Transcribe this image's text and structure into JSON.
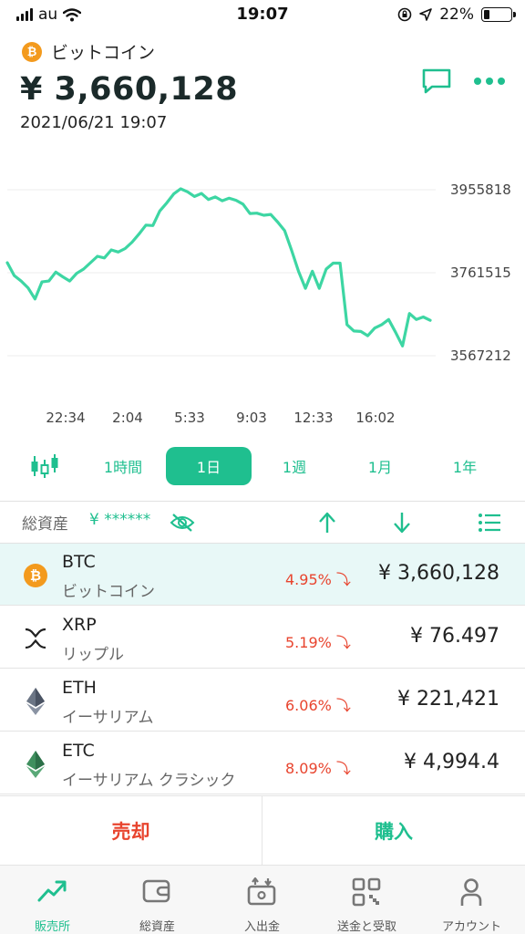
{
  "status_bar": {
    "carrier": "au",
    "time": "19:07",
    "battery": "22%"
  },
  "header": {
    "coin_name": "ビットコイン",
    "coin_symbol_glyph": "₿",
    "price": "¥ 3,660,128",
    "datetime": "2021/06/21 19:07",
    "icons": [
      "chat-icon",
      "more-icon"
    ]
  },
  "chart": {
    "y_labels": [
      "3955818",
      "3761515",
      "3567212"
    ],
    "x_labels": [
      "22:34",
      "2:04",
      "5:33",
      "9:03",
      "12:33",
      "16:02"
    ],
    "line_color": "#3dd6a3"
  },
  "chart_data": {
    "type": "line",
    "title": "",
    "xlabel": "",
    "ylabel": "",
    "x_ticks": [
      "22:34",
      "2:04",
      "5:33",
      "9:03",
      "12:33",
      "16:02"
    ],
    "y_ticks": [
      3955818,
      3761515,
      3567212
    ],
    "ylim": [
      3567212,
      3955818
    ],
    "series": [
      {
        "values": [
          3785000,
          3755000,
          3742000,
          3726000,
          3700000,
          3740000,
          3742000,
          3763000,
          3752000,
          3742000,
          3760000,
          3770000,
          3785000,
          3800000,
          3796000,
          3815000,
          3810000,
          3818000,
          3833000,
          3852000,
          3873000,
          3872000,
          3906000,
          3925000,
          3946000,
          3958000,
          3951000,
          3940000,
          3947000,
          3933000,
          3939000,
          3930000,
          3936000,
          3931000,
          3922000,
          3900000,
          3901000,
          3896000,
          3898000,
          3880000,
          3860000,
          3814000,
          3765000,
          3725000,
          3765000,
          3725000,
          3770000,
          3784000,
          3784000,
          3640000,
          3625000,
          3624000,
          3614000,
          3632000,
          3640000,
          3652000,
          3622000,
          3590000,
          3666000,
          3652000,
          3658000,
          3650000
        ]
      }
    ]
  },
  "range_tabs": {
    "tabs": [
      "1時間",
      "1日",
      "1週",
      "1月",
      "1年"
    ],
    "active": "1日"
  },
  "assets": {
    "label": "総資産",
    "masked_value": "¥ ******"
  },
  "coins": [
    {
      "symbol": "BTC",
      "name": "ビットコイン",
      "change": "4.95%",
      "price": "¥ 3,660,128"
    },
    {
      "symbol": "XRP",
      "name": "リップル",
      "change": "5.19%",
      "price": "¥ 76.497"
    },
    {
      "symbol": "ETH",
      "name": "イーサリアム",
      "change": "6.06%",
      "price": "¥ 221,421"
    },
    {
      "symbol": "ETC",
      "name": "イーサリアム クラシック",
      "change": "8.09%",
      "price": "¥ 4,994.4"
    }
  ],
  "actions": {
    "sell": "売却",
    "buy": "購入"
  },
  "nav": {
    "items": [
      "販売所",
      "総資産",
      "入出金",
      "送金と受取",
      "アカウント"
    ],
    "active": "販売所"
  },
  "colors": {
    "accent": "#1fbf8f",
    "negative": "#e8442e",
    "btc": "#f39a1d",
    "selected_row": "#e8f8f7"
  }
}
